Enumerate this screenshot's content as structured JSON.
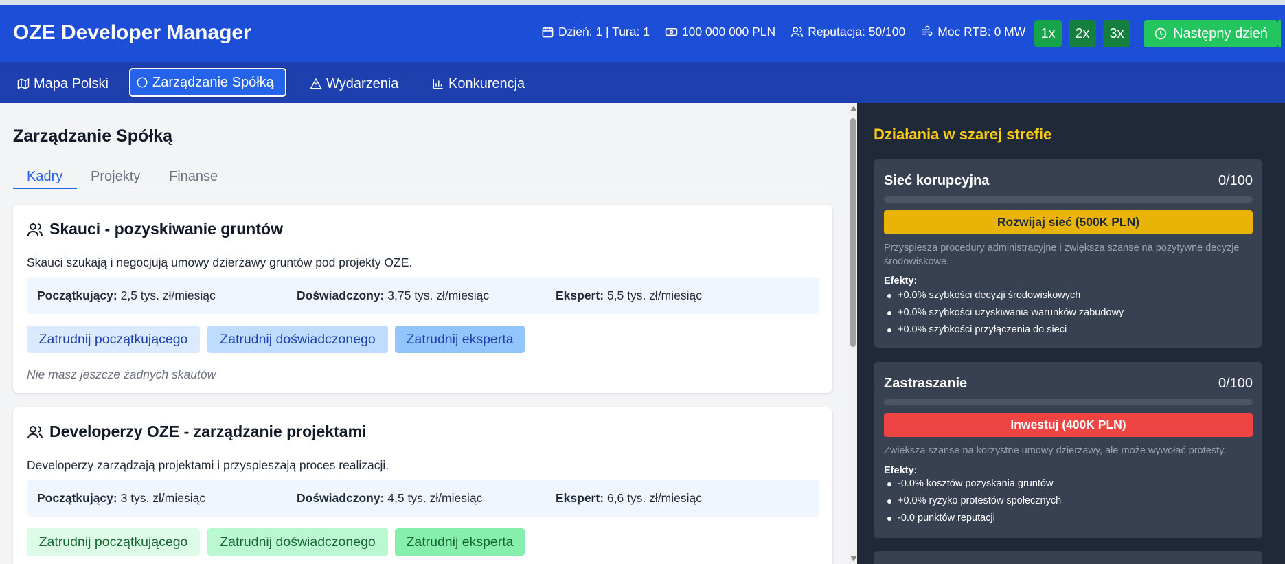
{
  "app": {
    "title": "OZE Developer Manager"
  },
  "stats": {
    "day_turn": "Dzień: 1 | Tura: 1",
    "money": "100 000 000 PLN",
    "reputation": "Reputacja: 50/100",
    "power": "Moc RTB: 0 MW"
  },
  "speed": {
    "x1": "1x",
    "x2": "2x",
    "x3": "3x"
  },
  "next_day": "Następny dzień",
  "nav": [
    {
      "label": "Mapa Polski",
      "icon": "map-icon"
    },
    {
      "label": "Zarządzanie Spółką",
      "icon": "circle-icon"
    },
    {
      "label": "Wydarzenia",
      "icon": "alert-triangle-icon"
    },
    {
      "label": "Konkurencja",
      "icon": "bar-chart-icon"
    }
  ],
  "page": {
    "title": "Zarządzanie Spółką",
    "tabs": [
      "Kadry",
      "Projekty",
      "Finanse"
    ],
    "active_tab": "Kadry"
  },
  "cards": [
    {
      "title": "Skauci - pozyskiwanie gruntów",
      "description": "Skauci szukają i negocjują umowy dzierżawy gruntów pod projekty OZE.",
      "salaries": [
        {
          "level": "Początkujący:",
          "value": "2,5 tys. zł/miesiąc"
        },
        {
          "level": "Doświadczony:",
          "value": "3,75 tys. zł/miesiąc"
        },
        {
          "level": "Ekspert:",
          "value": "5,5 tys. zł/miesiąc"
        }
      ],
      "buttons": [
        "Zatrudnij początkującego",
        "Zatrudnij doświadczonego",
        "Zatrudnij eksperta"
      ],
      "empty_note": "Nie masz jeszcze żadnych skautów"
    },
    {
      "title": "Developerzy OZE - zarządzanie projektami",
      "description": "Developerzy zarządzają projektami i przyspieszają proces realizacji.",
      "salaries": [
        {
          "level": "Początkujący:",
          "value": "3 tys. zł/miesiąc"
        },
        {
          "level": "Doświadczony:",
          "value": "4,5 tys. zł/miesiąc"
        },
        {
          "level": "Ekspert:",
          "value": "6,6 tys. zł/miesiąc"
        }
      ],
      "buttons": [
        "Zatrudnij początkującego",
        "Zatrudnij doświadczonego",
        "Zatrudnij eksperta"
      ]
    }
  ],
  "grey_zone": {
    "title": "Działania w szarej strefie",
    "items": [
      {
        "title": "Sieć korupcyjna",
        "score": "0/100",
        "level": 0,
        "button": "Rozwijaj sieć (500K PLN)",
        "description": "Przyspiesza procedury administracyjne i zwiększa szanse na pozytywne decyzje środowiskowe.",
        "effects_label": "Efekty:",
        "effects": [
          "+0.0% szybkości decyzji środowiskowych",
          "+0.0% szybkości uzyskiwania warunków zabudowy",
          "+0.0% szybkości przyłączenia do sieci"
        ]
      },
      {
        "title": "Zastraszanie",
        "score": "0/100",
        "level": 0,
        "button": "Inwestuj (400K PLN)",
        "description": "Zwiększa szanse na korzystne umowy dzierżawy, ale może wywołać protesty.",
        "effects_label": "Efekty:",
        "effects": [
          "-0.0% kosztów pozyskania gruntów",
          "+0.0% ryzyko protestów społecznych",
          "-0.0 punktów reputacji"
        ]
      }
    ]
  },
  "colors": {
    "header": "#1d4ed8",
    "nav": "#1e40af",
    "accent_green": "#22c55e",
    "side_bg": "#1f2937",
    "side_title": "#facc15",
    "btn_yellow": "#eab308",
    "btn_red": "#ef4444"
  }
}
